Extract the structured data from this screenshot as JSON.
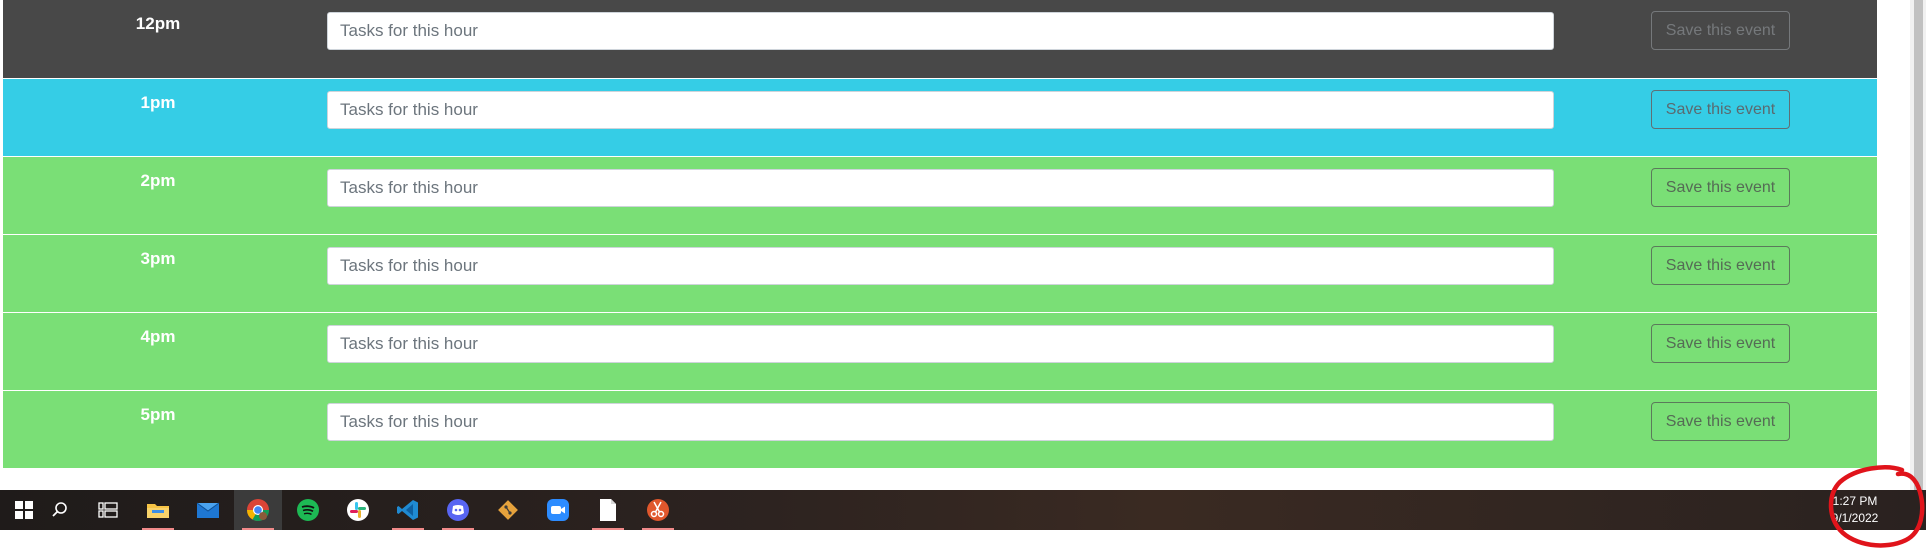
{
  "schedule": {
    "placeholder": "Tasks for this hour",
    "save_label": "Save this event",
    "rows": [
      {
        "hour": "12pm",
        "state": "past"
      },
      {
        "hour": "1pm",
        "state": "present"
      },
      {
        "hour": "2pm",
        "state": "future"
      },
      {
        "hour": "3pm",
        "state": "future"
      },
      {
        "hour": "4pm",
        "state": "future"
      },
      {
        "hour": "5pm",
        "state": "future"
      }
    ]
  },
  "colors": {
    "past": "#484848",
    "present": "#35cde6",
    "future": "#7adf76",
    "annotation": "#e0141b"
  },
  "taskbar": {
    "items": [
      {
        "name": "start-windows-icon"
      },
      {
        "name": "search-icon"
      },
      {
        "name": "task-view-icon"
      },
      {
        "name": "file-explorer-icon"
      },
      {
        "name": "mail-icon"
      },
      {
        "name": "chrome-icon"
      },
      {
        "name": "spotify-icon"
      },
      {
        "name": "slack-icon"
      },
      {
        "name": "vscode-icon"
      },
      {
        "name": "discord-icon"
      },
      {
        "name": "git-icon"
      },
      {
        "name": "zoom-icon"
      },
      {
        "name": "notepad-icon"
      },
      {
        "name": "snipping-tool-icon"
      }
    ],
    "time": "1:27 PM",
    "date": "9/1/2022"
  }
}
